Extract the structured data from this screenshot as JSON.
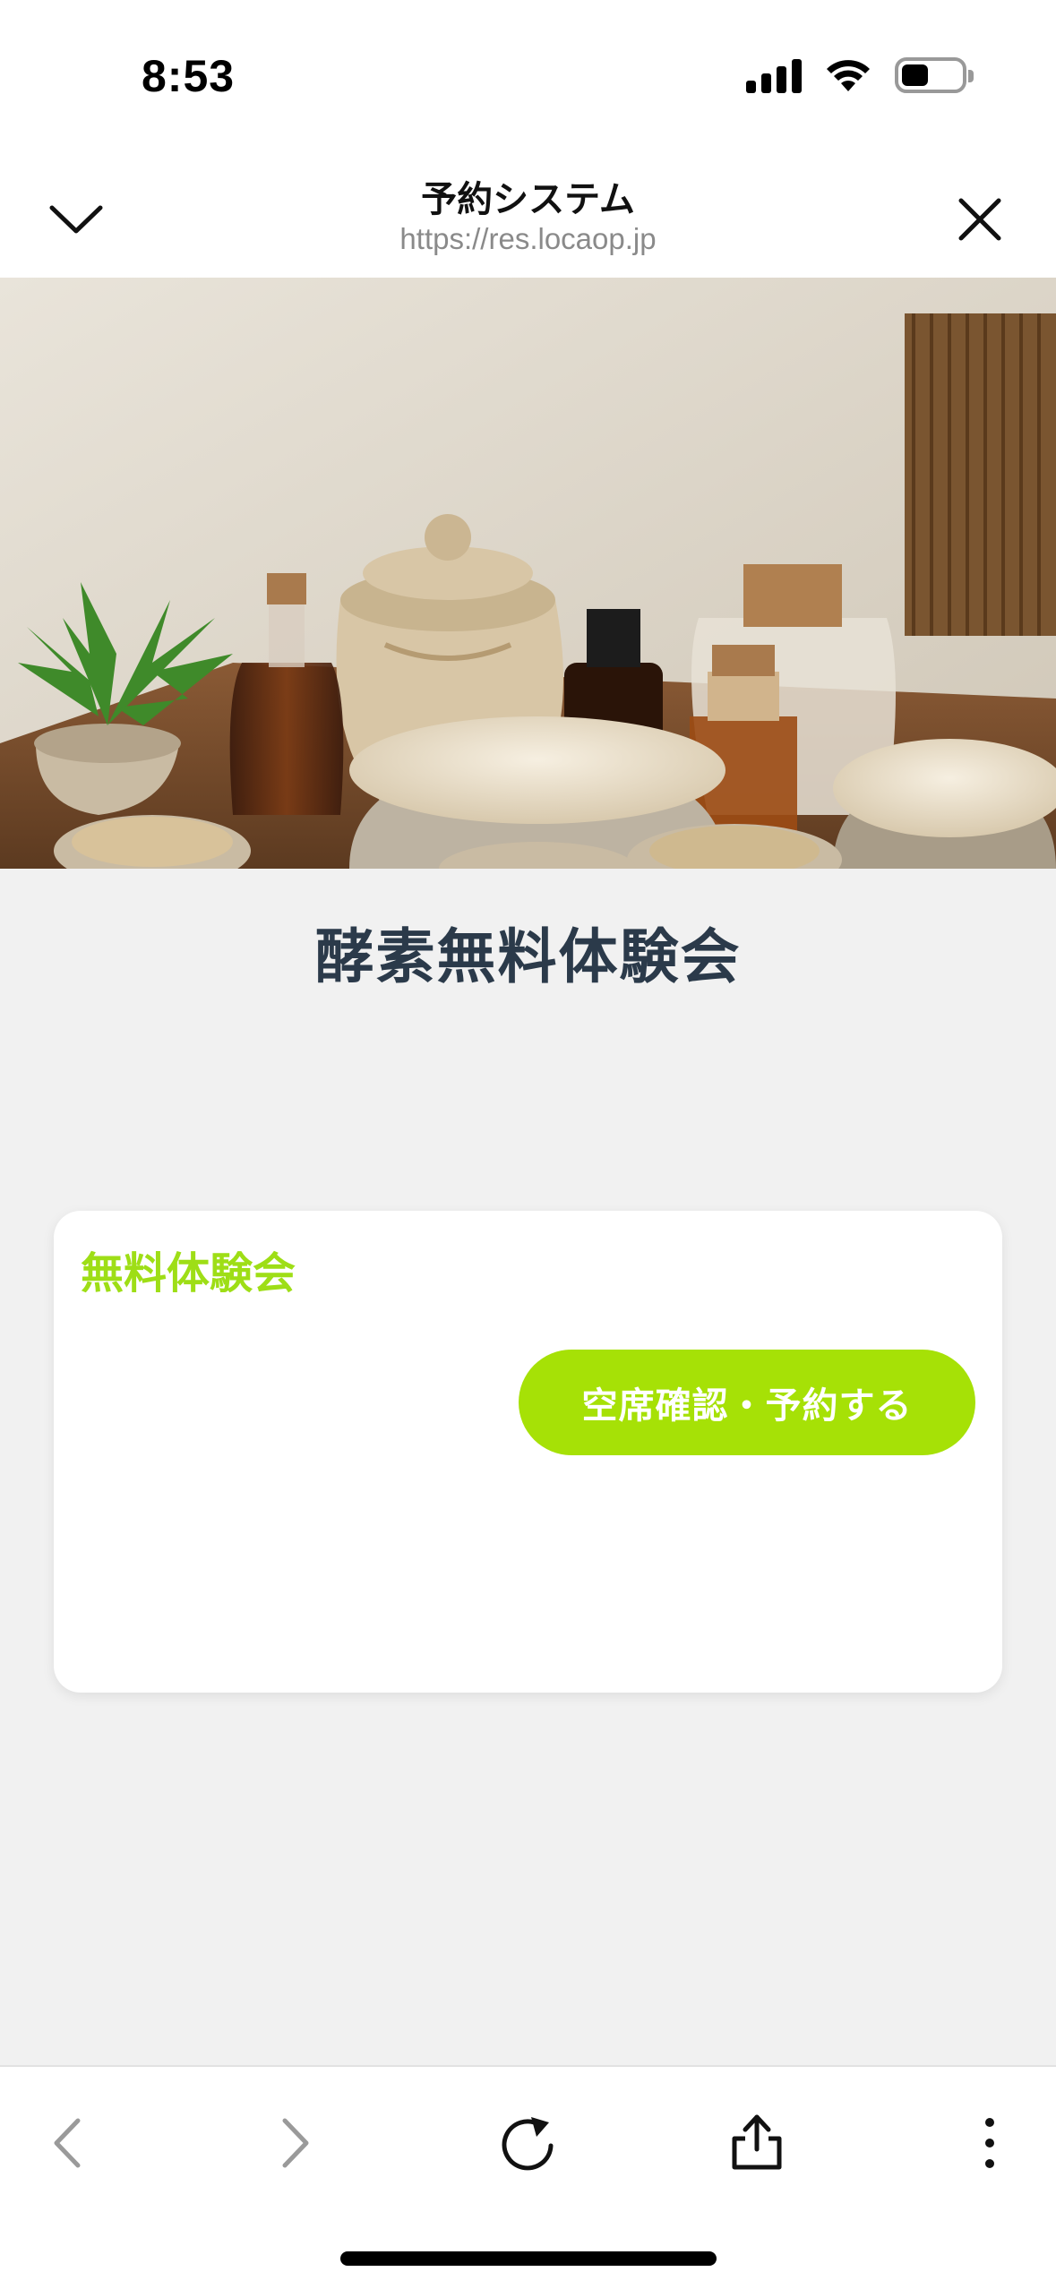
{
  "status_bar": {
    "time": "8:53"
  },
  "browser": {
    "title": "予約システム",
    "url": "https://res.locaop.jp"
  },
  "hero": {
    "alt": ""
  },
  "page": {
    "title": "酵素無料体験会"
  },
  "event_card": {
    "title": "無料体験会",
    "button_label": "空席確認・予約する"
  },
  "colors": {
    "accent_green": "#a6e106",
    "card_title_green": "#9ede16",
    "title_navy": "#2b3a4a",
    "background": "#f1f1f1"
  },
  "toolbar": {
    "icons": [
      "back-icon",
      "forward-icon",
      "reload-icon",
      "share-icon",
      "more-icon"
    ]
  }
}
